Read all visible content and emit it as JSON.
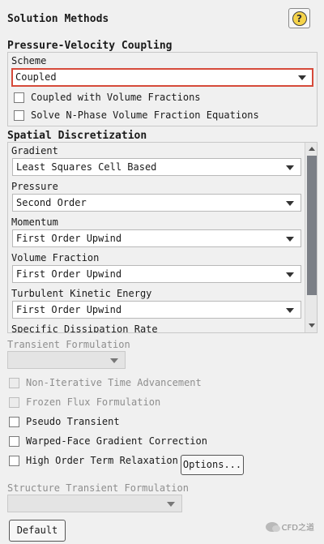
{
  "panel": {
    "title": "Solution Methods",
    "help_glyph": "?"
  },
  "pressure_velocity": {
    "section_title": "Pressure-Velocity Coupling",
    "scheme_label": "Scheme",
    "scheme_value": "Coupled",
    "coupled_vf_label": "Coupled with Volume Fractions",
    "coupled_vf_checked": false,
    "nphase_label": "Solve N-Phase Volume Fraction Equations",
    "nphase_checked": false
  },
  "spatial": {
    "section_title": "Spatial Discretization",
    "items": [
      {
        "label": "Gradient",
        "value": "Least Squares Cell Based"
      },
      {
        "label": "Pressure",
        "value": "Second Order"
      },
      {
        "label": "Momentum",
        "value": "First Order Upwind"
      },
      {
        "label": "Volume Fraction",
        "value": "First Order Upwind"
      },
      {
        "label": "Turbulent Kinetic Energy",
        "value": "First Order Upwind"
      },
      {
        "label": "Specific Dissipation Rate",
        "value": ""
      }
    ]
  },
  "transient": {
    "label": "Transient Formulation",
    "value": "",
    "non_iterative_label": "Non-Iterative Time Advancement",
    "frozen_flux_label": "Frozen Flux Formulation",
    "pseudo_transient_label": "Pseudo Transient",
    "warped_face_label": "Warped-Face Gradient Correction",
    "high_order_label": "High Order Term Relaxation",
    "options_button": "Options...",
    "structure_label": "Structure Transient Formulation",
    "structure_value": ""
  },
  "footer": {
    "default_button": "Default"
  },
  "watermark": {
    "text": "CFD之道"
  },
  "colors": {
    "highlight_border": "#d64a3a",
    "help_icon_fill": "#f5d34a",
    "scroll_thumb": "#7b7f86"
  }
}
